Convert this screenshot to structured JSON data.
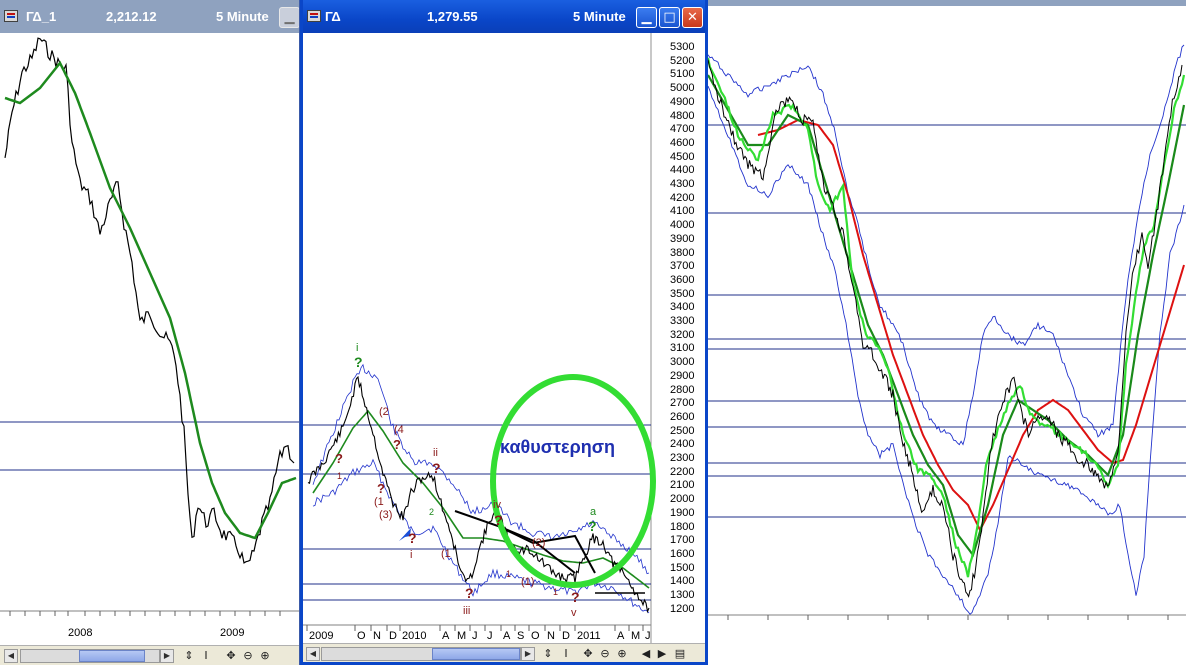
{
  "windows": [
    {
      "name": "ΓΔ_1",
      "value": "2,212.12",
      "interval": "5 Minute"
    },
    {
      "name": "ΓΔ",
      "value": "1,279.55",
      "interval": "5 Minute"
    }
  ],
  "controls": {
    "minimize": "▁",
    "maximize": "□",
    "close": "✕"
  },
  "toolbar": {
    "sync": "⇕",
    "cursor": "I",
    "move": "✥",
    "zoom_out": "⊖",
    "zoom_in": "⊕",
    "left": "◀",
    "right": "▶",
    "end": "▤"
  },
  "left_chart": {
    "x_labels": [
      "2008",
      "2009"
    ],
    "colors": {
      "price": "#000000",
      "ma": "#1e8a1e",
      "hline": "#1f2f8a"
    }
  },
  "mid_chart": {
    "annotation": "καθυστερηση",
    "x_labels": [
      "2009",
      "O",
      "N",
      "D",
      "2010",
      "A",
      "M",
      "J",
      "J",
      "A",
      "S",
      "O",
      "N",
      "D",
      "2011",
      "A",
      "M",
      "J"
    ],
    "wave_labels": [
      {
        "text": "i",
        "color": "#1e8a1e"
      },
      {
        "text": "?",
        "color": "#1e8a1e"
      },
      {
        "text": "?",
        "color": "#8b1a1a"
      },
      {
        "text": "(1",
        "color": "#8b1a1a"
      },
      {
        "text": "?",
        "color": "#8b1a1a"
      },
      {
        "text": "(2",
        "color": "#8b1a1a"
      },
      {
        "text": "(4",
        "color": "#8b1a1a"
      },
      {
        "text": "?",
        "color": "#8b1a1a"
      },
      {
        "text": "(3)",
        "color": "#8b1a1a"
      },
      {
        "text": "ii",
        "color": "#8b1a1a"
      },
      {
        "text": "?",
        "color": "#8b1a1a"
      },
      {
        "text": "?",
        "color": "#8b1a1a"
      },
      {
        "text": "i",
        "color": "#8b1a1a"
      },
      {
        "text": "(1",
        "color": "#8b1a1a"
      },
      {
        "text": "iv",
        "color": "#8b1a1a"
      },
      {
        "text": "?",
        "color": "#8b1a1a"
      },
      {
        "text": "(2)",
        "color": "#8b1a1a"
      },
      {
        "text": "(1)",
        "color": "#8b1a1a"
      },
      {
        "text": "?",
        "color": "#8b1a1a"
      },
      {
        "text": "iii",
        "color": "#8b1a1a"
      },
      {
        "text": "?",
        "color": "#8b1a1a"
      },
      {
        "text": "v",
        "color": "#8b1a1a"
      },
      {
        "text": "a",
        "color": "#1e8a1e"
      },
      {
        "text": "?",
        "color": "#1e8a1e"
      },
      {
        "text": "1",
        "color": "#8b1a1a"
      },
      {
        "text": "2",
        "color": "#1e8a1e"
      },
      {
        "text": "1",
        "color": "#8b1a1a"
      },
      {
        "text": "1",
        "color": "#8b1a1a"
      }
    ],
    "colors": {
      "annotation": "#1f2fb0",
      "ellipse": "#33dd33",
      "wave_red": "#8b1a1a",
      "wave_green": "#1e8a1e"
    }
  },
  "right_chart": {
    "price_axis": [
      "5300",
      "5200",
      "5100",
      "5000",
      "4900",
      "4800",
      "4700",
      "4600",
      "4500",
      "4400",
      "4300",
      "4200",
      "4100",
      "4000",
      "3900",
      "3800",
      "3700",
      "3600",
      "3500",
      "3400",
      "3300",
      "3200",
      "3100",
      "3000",
      "2900",
      "2800",
      "2700",
      "2600",
      "2500",
      "2400",
      "2300",
      "2200",
      "2100",
      "2000",
      "1900",
      "1800",
      "1700",
      "1600",
      "1500",
      "1400",
      "1300",
      "1200"
    ],
    "colors": {
      "price": "#000000",
      "bands": "#2233cc",
      "slow": "#dd1111",
      "fast": "#33dd33",
      "mid": "#1a8a1a"
    }
  }
}
